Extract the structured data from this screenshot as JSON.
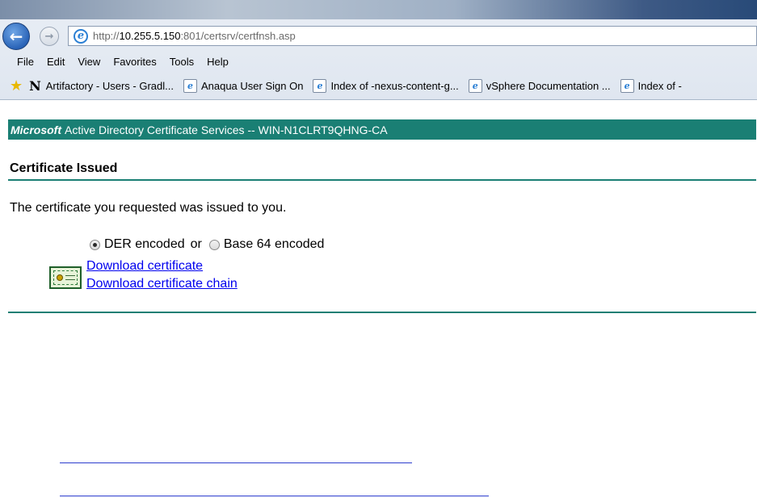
{
  "browser": {
    "url": {
      "prefix": "http://",
      "host": "10.255.5.150",
      "rest": ":801/certsrv/certfnsh.asp"
    },
    "menu": [
      {
        "label": "File"
      },
      {
        "label": "Edit"
      },
      {
        "label": "View"
      },
      {
        "label": "Favorites"
      },
      {
        "label": "Tools"
      },
      {
        "label": "Help"
      }
    ],
    "favorites": [
      {
        "label": "Artifactory - Users - Gradl..."
      },
      {
        "label": "Anaqua User Sign On"
      },
      {
        "label": "Index of -nexus-content-g..."
      },
      {
        "label": "vSphere Documentation ..."
      },
      {
        "label": "Index of -"
      }
    ]
  },
  "page": {
    "banner": {
      "brand": "Microsoft",
      "text": "Active Directory Certificate Services  --  WIN-N1CLRT9QHNG-CA"
    },
    "title": "Certificate Issued",
    "message": "The certificate you requested was issued to you.",
    "encoding": {
      "der_label": "DER encoded",
      "or_label": "or",
      "base64_label": "Base 64 encoded",
      "selected": "DER encoded"
    },
    "links": {
      "download_cert": "Download certificate",
      "download_chain": "Download certificate chain"
    }
  },
  "colors": {
    "accent": "#1a7f74",
    "link": "#0000ee"
  },
  "icons": {
    "back": "back-arrow-icon",
    "forward": "forward-arrow-icon",
    "ie": "internet-explorer-icon",
    "favorites": "favorites-star-icon",
    "certificate": "certificate-icon"
  }
}
